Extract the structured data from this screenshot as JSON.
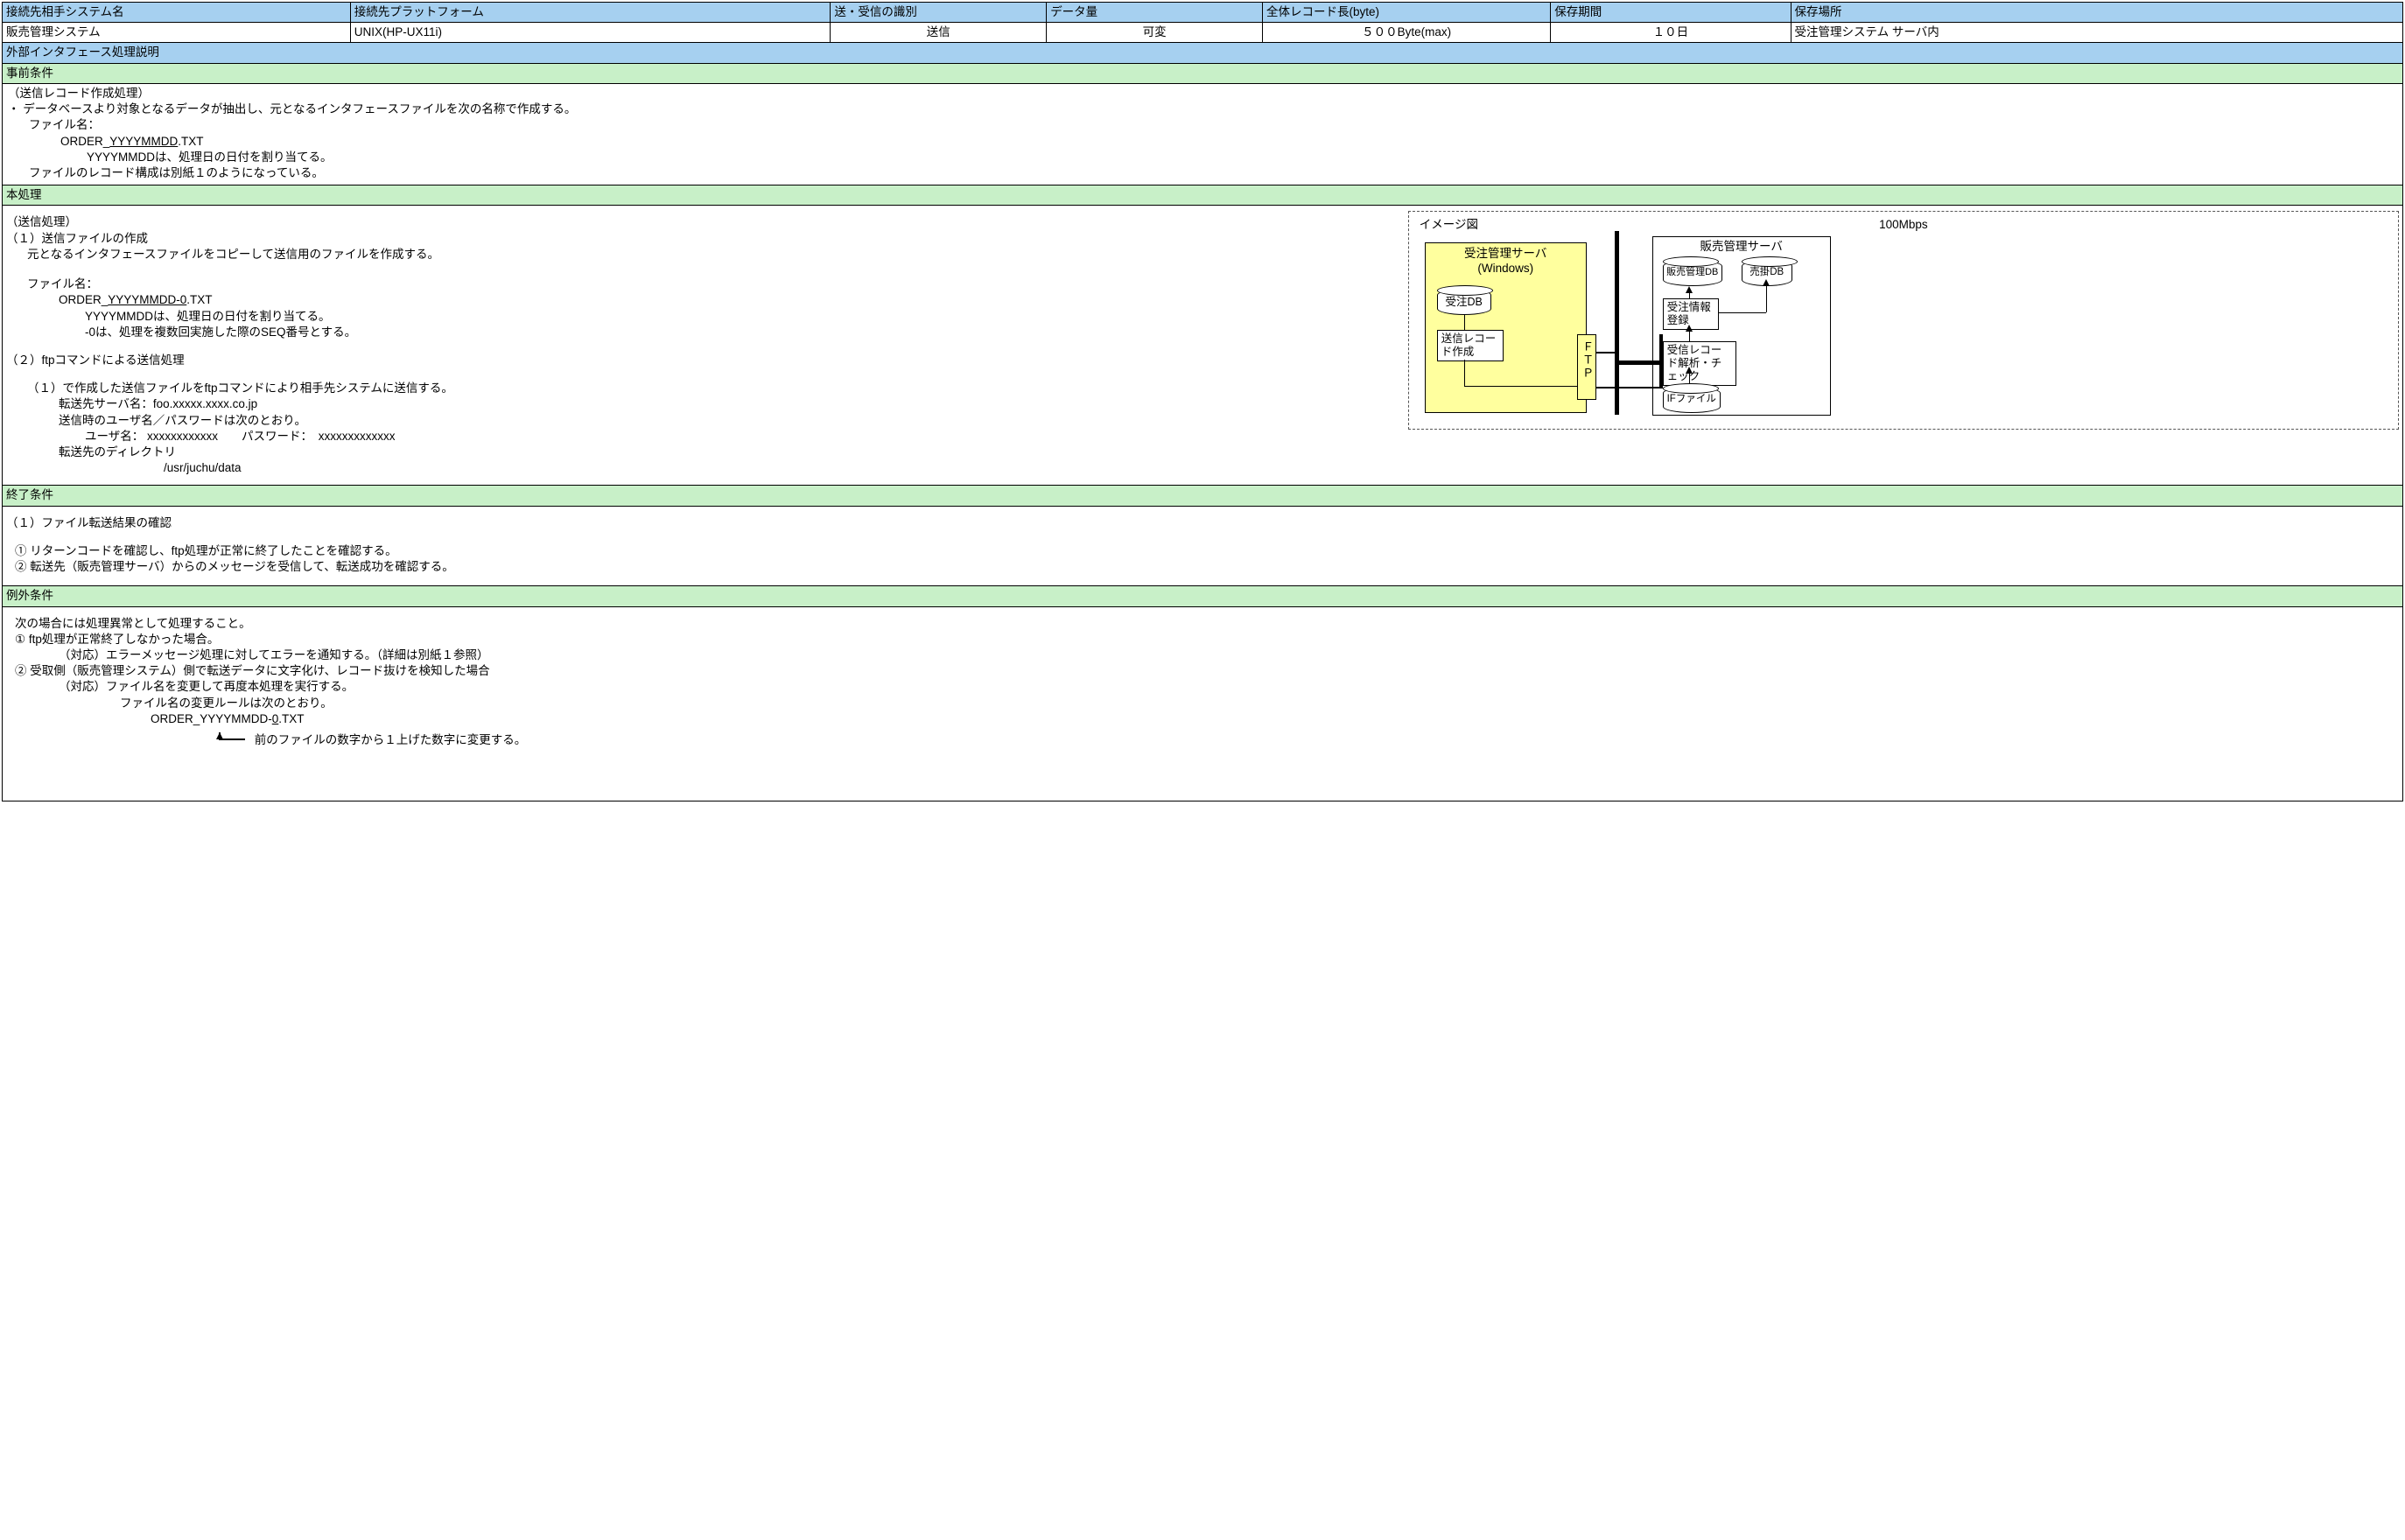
{
  "header": {
    "h1": "接続先相手システム名",
    "h2": "接続先プラットフォーム",
    "h3": "送・受信の識別",
    "h4": "データ量",
    "h5": "全体レコード長(byte)",
    "h6": "保存期間",
    "h7": "保存場所",
    "v1": "販売管理システム",
    "v2": "UNIX(HP-UX11i)",
    "v3": "送信",
    "v4": "可変",
    "v5": "５００Byte(max)",
    "v6": "１０日",
    "v7": "受注管理システム サーバ内"
  },
  "sec": {
    "s1": "外部インタフェース処理説明",
    "s2": "事前条件",
    "s3": "本処理",
    "s4": "終了条件",
    "s5": "例外条件"
  },
  "pre": {
    "l1": "（送信レコード作成処理）",
    "l2": "・ データベースより対象となるデータが抽出し、元となるインタフェースファイルを次の名称で作成する。",
    "l3": "ファイル名：",
    "l4a": "ORDER_",
    "l4b": "YYYYMMDD",
    "l4c": ".TXT",
    "l5": "YYYYMMDDは、処理日の日付を割り当てる。",
    "l6": "ファイルのレコード構成は別紙１のようになっている。"
  },
  "main": {
    "l1": "（送信処理）",
    "l2": "（１）送信ファイルの作成",
    "l3": "元となるインタフェースファイルをコピーして送信用のファイルを作成する。",
    "l4": "ファイル名：",
    "l5a": "ORDER_",
    "l5b": "YYYYMMDD-0",
    "l5c": ".TXT",
    "l6": "YYYYMMDDは、処理日の日付を割り当てる。",
    "l7": "-0は、処理を複数回実施した際のSEQ番号とする。",
    "l8": "（２）ftpコマンドによる送信処理",
    "l9": "（１）で作成した送信ファイルをftpコマンドにより相手先システムに送信する。",
    "l10": "転送先サーバ名：foo.xxxxx.xxxx.co.jp",
    "l11": "送信時のユーザ名／パスワードは次のとおり。",
    "l12": "ユーザ名： xxxxxxxxxxxx　　パスワード：　xxxxxxxxxxxxx",
    "l13": "転送先のディレクトリ",
    "l14": "/usr/juchu/data"
  },
  "diag": {
    "title": "イメージ図",
    "speed": "100Mbps",
    "server1a": "受注管理サーバ",
    "server1b": "(Windows)",
    "db1": "受注DB",
    "proc1": "送信レコード作成",
    "ftp": "ＦＴＰ",
    "server2": "販売管理サーバ",
    "db2": "販売管理DB",
    "db3": "売掛DB",
    "proc2": "受注情報登録",
    "proc3": "受信レコード解析・チェック",
    "db4": "IFファイル"
  },
  "end": {
    "l1": "（１）ファイル転送結果の確認",
    "l2": "① リターンコードを確認し、ftp処理が正常に終了したことを確認する。",
    "l3": "② 転送先（販売管理サーバ）からのメッセージを受信して、転送成功を確認する。"
  },
  "exc": {
    "l1": "次の場合には処理異常として処理すること。",
    "l2": "① ftp処理が正常終了しなかった場合。",
    "l3": "（対応）エラーメッセージ処理に対してエラーを通知する。（詳細は別紙１参照）",
    "l4": "② 受取側（販売管理システム）側で転送データに文字化け、レコード抜けを検知した場合",
    "l5": "（対応）ファイル名を変更して再度本処理を実行する。",
    "l6": "ファイル名の変更ルールは次のとおり。",
    "l7a": "ORDER_YYYYMMDD-",
    "l7b": "0",
    "l7c": ".TXT",
    "l8": "前のファイルの数字から１上げた数字に変更する。"
  }
}
